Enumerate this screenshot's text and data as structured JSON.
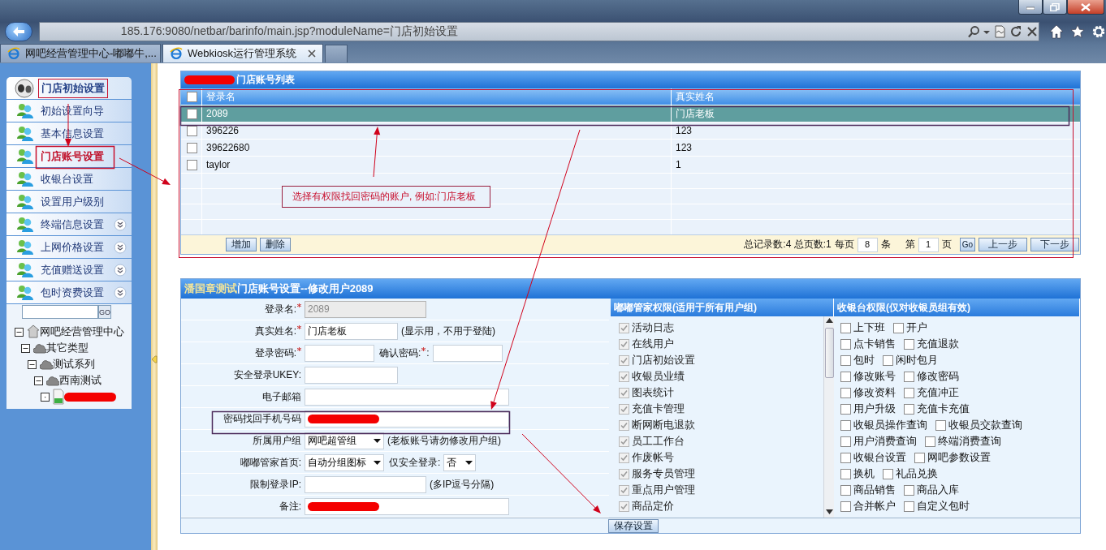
{
  "browser": {
    "address": "185.176:9080/netbar/barinfo/main.jsp?moduleName=门店初始设置",
    "tabs": [
      {
        "label": "网吧经营管理中心-嘟嘟牛,...",
        "selected": false
      },
      {
        "label": "Webkiosk运行管理系统",
        "selected": true
      }
    ]
  },
  "sidebar": {
    "title": "门店初始设置",
    "items": [
      {
        "label": "初始设置向导",
        "selected": false,
        "expandable": false
      },
      {
        "label": "基本信息设置",
        "selected": false,
        "expandable": false
      },
      {
        "label": "门店账号设置",
        "selected": true,
        "expandable": false
      },
      {
        "label": "收银台设置",
        "selected": false,
        "expandable": false
      },
      {
        "label": "设置用户级别",
        "selected": false,
        "expandable": false
      },
      {
        "label": "终端信息设置",
        "selected": false,
        "expandable": true
      },
      {
        "label": "上网价格设置",
        "selected": false,
        "expandable": true
      },
      {
        "label": "充值赠送设置",
        "selected": false,
        "expandable": true
      },
      {
        "label": "包时资费设置",
        "selected": false,
        "expandable": true
      }
    ],
    "tree_search_button": "GO",
    "tree": [
      {
        "label": "网吧经营管理中心",
        "kind": "center",
        "expanded": true,
        "children": [
          {
            "label": "其它类型",
            "kind": "group",
            "expanded": true,
            "children": [
              {
                "label": "测试系列",
                "kind": "group",
                "expanded": true,
                "children": [
                  {
                    "label": "西南测试",
                    "kind": "group",
                    "expanded": true,
                    "children": [
                      {
                        "kind": "terminal",
                        "redacted": true
                      }
                    ]
                  }
                ]
              }
            ]
          }
        ]
      }
    ]
  },
  "account_list": {
    "title_redacted": true,
    "title": "门店账号列表",
    "select_all_checked": false,
    "columns": [
      "登录名",
      "真实姓名"
    ],
    "rows": [
      {
        "login": "2089",
        "real_name": "门店老板",
        "selected": true,
        "checked": false
      },
      {
        "login": "396226",
        "real_name": "123",
        "selected": false,
        "checked": false
      },
      {
        "login": "39622680",
        "real_name": "123",
        "selected": false,
        "checked": false
      },
      {
        "login": "taylor",
        "real_name": "1",
        "selected": false,
        "checked": false
      }
    ],
    "buttons": [
      "增加",
      "删除"
    ],
    "pager": {
      "summary": "总记录数:4 总页数:1",
      "per_page_label": "每页",
      "per_page": "8",
      "per_page_unit": "条",
      "page_label": "第",
      "page": "1",
      "page_unit": "页",
      "go": "Go",
      "prev": "上一步",
      "next": "下一步"
    }
  },
  "edit_form": {
    "owner": "潘国章测试",
    "title": "门店账号设置--修改用户2089",
    "fields": [
      {
        "label": "登录名:",
        "required": true,
        "controls": [
          {
            "kind": "input",
            "value": "2089",
            "disabled": true
          }
        ]
      },
      {
        "label": "真实姓名:",
        "required": true,
        "controls": [
          {
            "kind": "input",
            "value": "门店老板",
            "disabled": false
          },
          {
            "kind": "hint",
            "text": "(显示用，不用于登陆)"
          }
        ]
      },
      {
        "label": "登录密码:",
        "required": true,
        "controls": [
          {
            "kind": "input",
            "disabled": false
          },
          {
            "kind": "label",
            "text": "确认密码:",
            "required": true,
            "suffix": ":"
          },
          {
            "kind": "input",
            "disabled": false
          }
        ]
      },
      {
        "label": "安全登录UKEY:",
        "required": false,
        "controls": [
          {
            "kind": "input",
            "disabled": false
          }
        ]
      },
      {
        "label": "电子邮箱",
        "required": false,
        "controls": [
          {
            "kind": "input",
            "disabled": false
          }
        ]
      },
      {
        "label": "密码找回手机号码",
        "required": false,
        "controls": [
          {
            "kind": "input",
            "redacted": true,
            "disabled": false
          }
        ]
      },
      {
        "label": "所属用户组",
        "required": false,
        "controls": [
          {
            "kind": "select",
            "value": "网吧超管组"
          },
          {
            "kind": "hint",
            "text": "(老板账号请勿修改用户组)"
          }
        ]
      },
      {
        "label": "嘟嘟管家首页:",
        "required": false,
        "controls": [
          {
            "kind": "select",
            "value": "自动分组图标"
          },
          {
            "kind": "label",
            "text": "仅安全登录:",
            "required": false
          },
          {
            "kind": "select",
            "value": "否"
          }
        ]
      },
      {
        "label": "限制登录IP:",
        "required": false,
        "controls": [
          {
            "kind": "input",
            "disabled": false
          },
          {
            "kind": "hint",
            "text": "(多IP逗号分隔)"
          }
        ]
      },
      {
        "label": "备注:",
        "required": false,
        "controls": [
          {
            "kind": "input",
            "redacted": true,
            "disabled": false
          }
        ]
      }
    ],
    "manager_permissions": {
      "title": "嘟嘟管家权限(适用于所有用户组)",
      "items": [
        {
          "label": "活动日志",
          "checked": true,
          "disabled": true
        },
        {
          "label": "在线用户",
          "checked": true,
          "disabled": true
        },
        {
          "label": "门店初始设置",
          "checked": true,
          "disabled": true
        },
        {
          "label": "收银员业绩",
          "checked": true,
          "disabled": true
        },
        {
          "label": "图表统计",
          "checked": true,
          "disabled": true
        },
        {
          "label": "充值卡管理",
          "checked": true,
          "disabled": true
        },
        {
          "label": "断网断电退款",
          "checked": true,
          "disabled": true
        },
        {
          "label": "员工工作台",
          "checked": true,
          "disabled": true
        },
        {
          "label": "作废帐号",
          "checked": true,
          "disabled": true
        },
        {
          "label": "服务专员管理",
          "checked": true,
          "disabled": true
        },
        {
          "label": "重点用户管理",
          "checked": true,
          "disabled": true
        },
        {
          "label": "商品定价",
          "checked": true,
          "disabled": true
        }
      ]
    },
    "cashier_permissions": {
      "title": "收银台权限(仅对收银员组有效)",
      "rows": [
        {
          "items": [
            {
              "label": "上下班",
              "checked": false
            },
            {
              "label": "开户",
              "checked": false
            }
          ]
        },
        {
          "items": [
            {
              "label": "点卡销售",
              "checked": false
            },
            {
              "label": "充值退款",
              "checked": false
            }
          ]
        },
        {
          "items": [
            {
              "label": "包时",
              "checked": false
            },
            {
              "label": "闲时包月",
              "checked": false
            }
          ]
        },
        {
          "items": [
            {
              "label": "修改账号",
              "checked": false
            },
            {
              "label": "修改密码",
              "checked": false
            }
          ]
        },
        {
          "items": [
            {
              "label": "修改资料",
              "checked": false
            },
            {
              "label": "充值冲正",
              "checked": false
            }
          ]
        },
        {
          "items": [
            {
              "label": "用户升级",
              "checked": false
            },
            {
              "label": "充值卡充值",
              "checked": false
            }
          ]
        },
        {
          "items": [
            {
              "label": "收银员操作查询",
              "checked": false
            },
            {
              "label": "收银员交款查询",
              "checked": false
            }
          ]
        },
        {
          "items": [
            {
              "label": "用户消费查询",
              "checked": false
            },
            {
              "label": "终端消费查询",
              "checked": false
            }
          ]
        },
        {
          "items": [
            {
              "label": "收银台设置",
              "checked": false
            },
            {
              "label": "网吧参数设置",
              "checked": false
            }
          ]
        },
        {
          "items": [
            {
              "label": "换机",
              "checked": false
            },
            {
              "label": "礼品兑换",
              "checked": false
            }
          ]
        },
        {
          "items": [
            {
              "label": "商品销售",
              "checked": false
            },
            {
              "label": "商品入库",
              "checked": false
            }
          ]
        },
        {
          "items": [
            {
              "label": "合并帐户",
              "checked": false
            },
            {
              "label": "自定义包时",
              "checked": false
            }
          ]
        }
      ]
    },
    "save_button": "保存设置"
  },
  "annotations": {
    "note": "选择有权限找回密码的账户, 例如:门店老板"
  }
}
